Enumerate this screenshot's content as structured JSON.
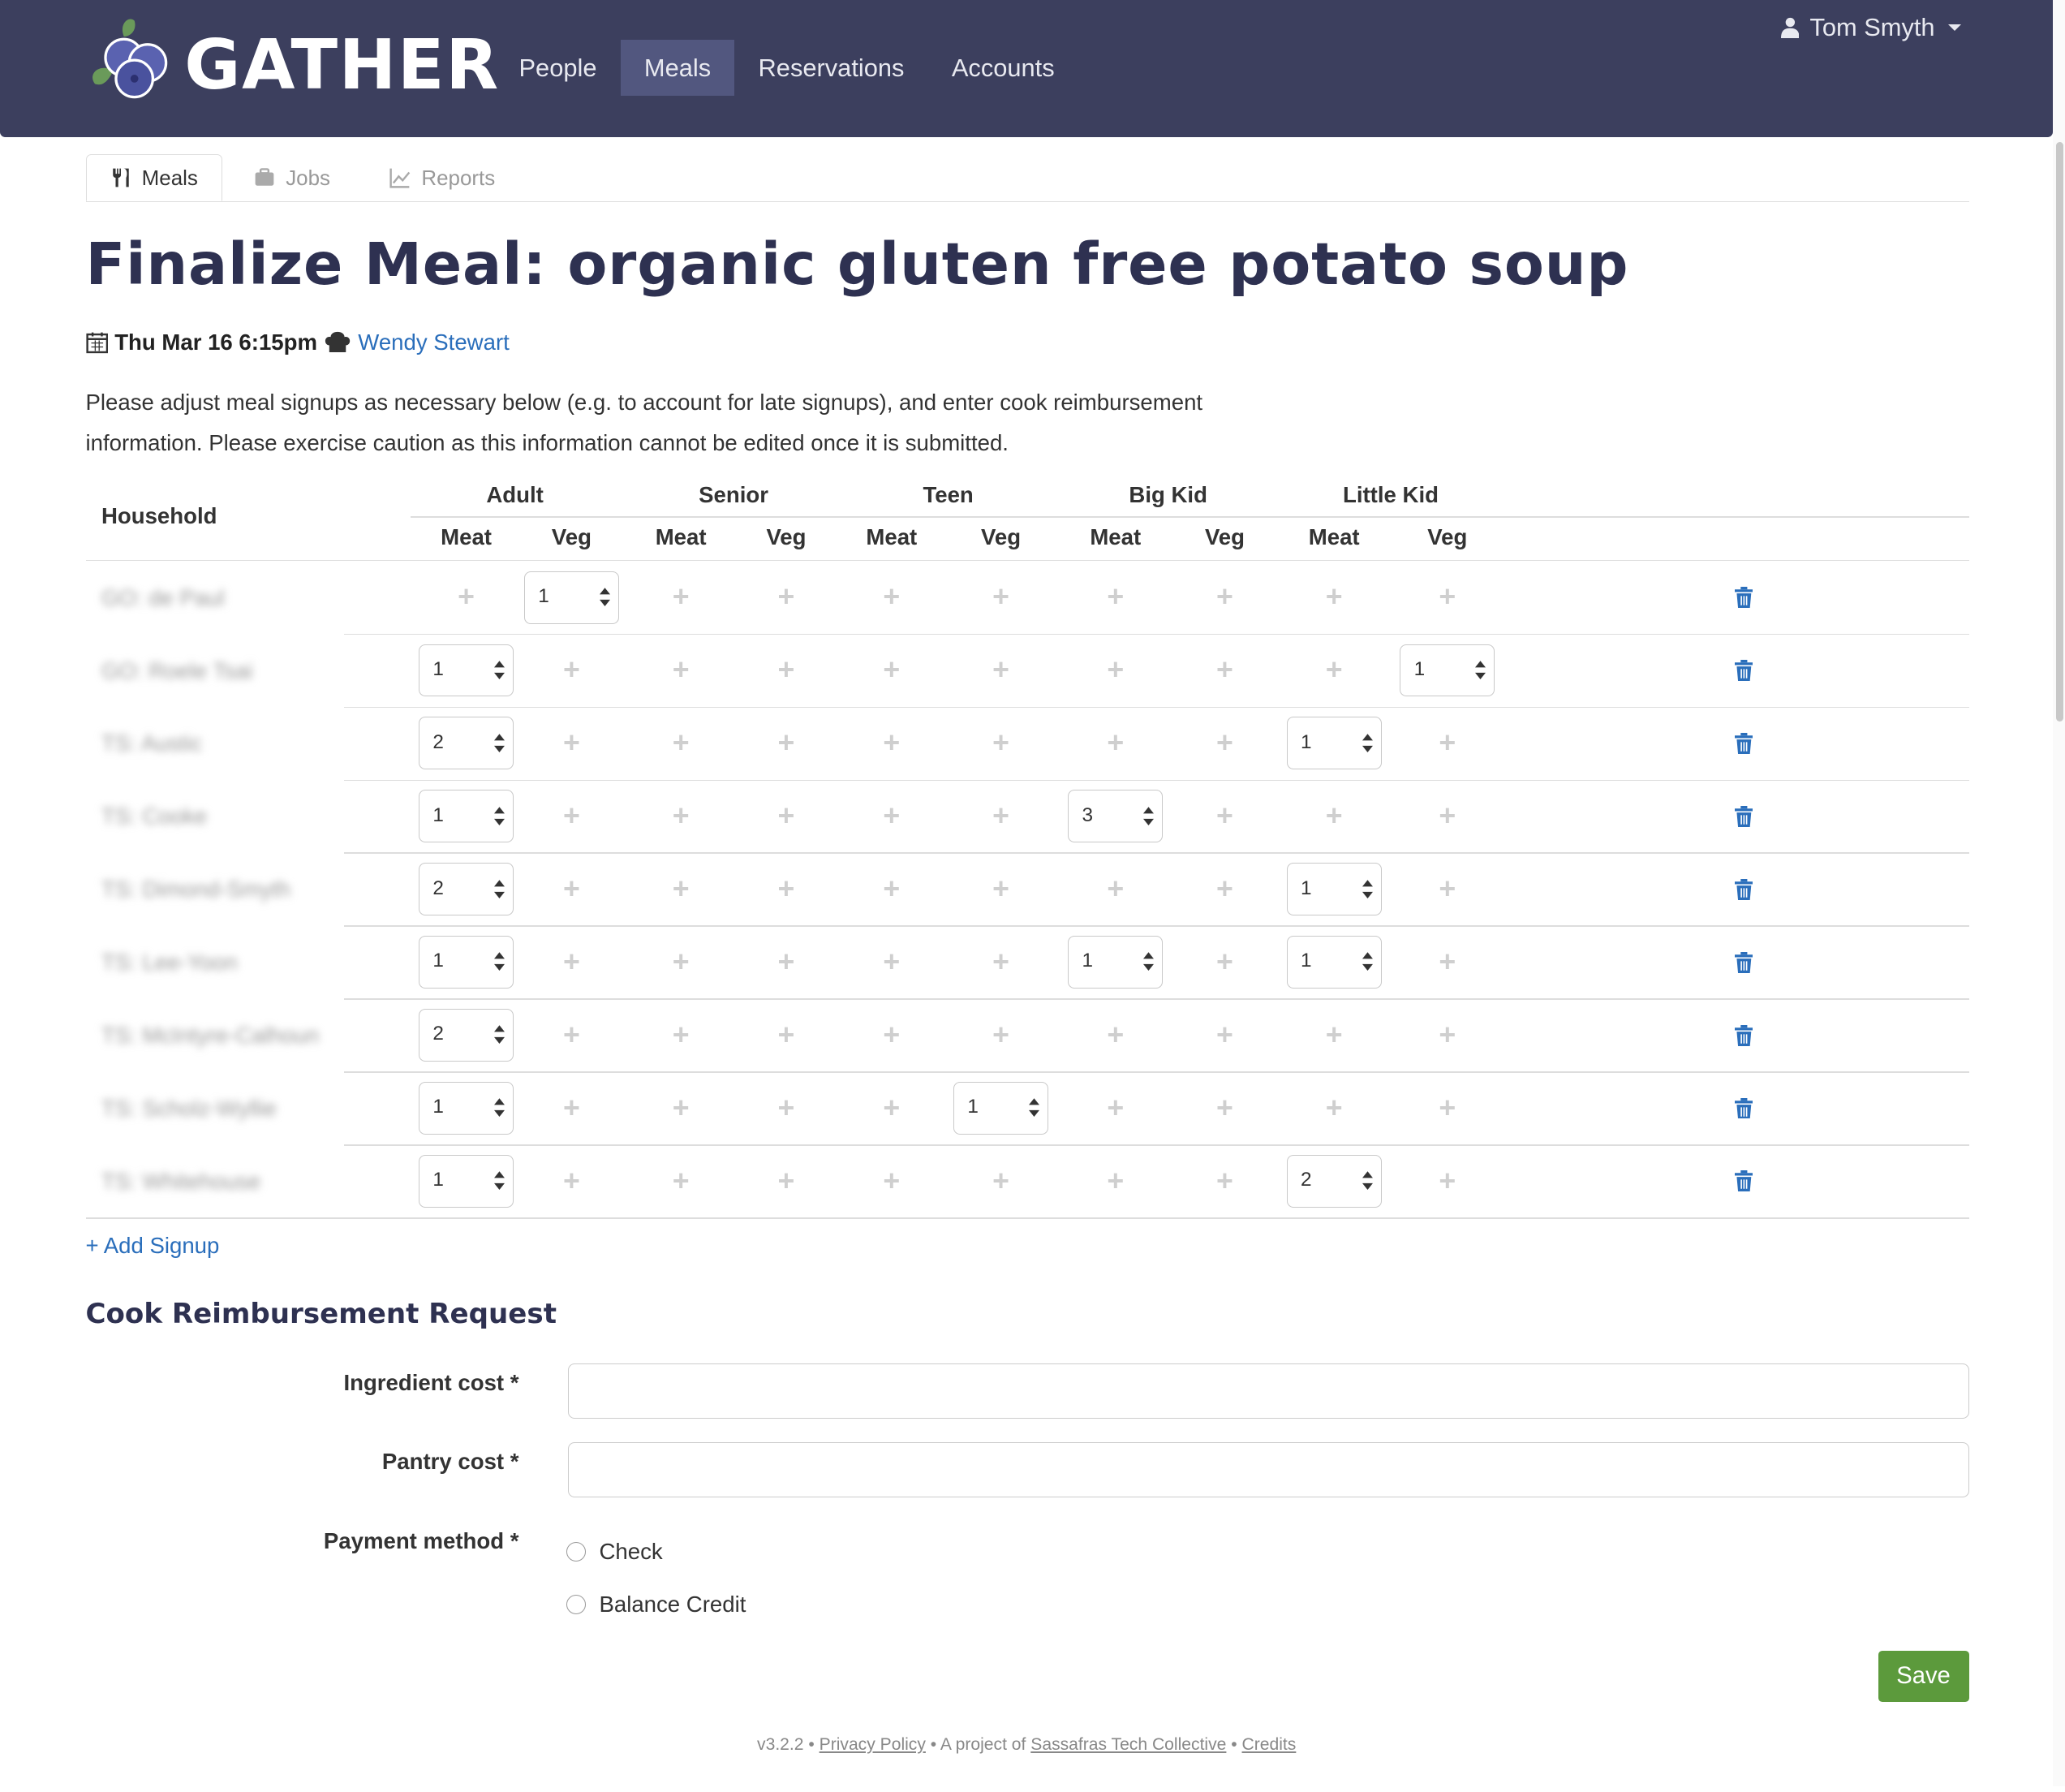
{
  "brand": {
    "name": "GATHER"
  },
  "nav": {
    "items": [
      {
        "label": "People",
        "active": false
      },
      {
        "label": "Meals",
        "active": true
      },
      {
        "label": "Reservations",
        "active": false
      },
      {
        "label": "Accounts",
        "active": false
      }
    ],
    "user": "Tom Smyth"
  },
  "subtabs": [
    {
      "label": "Meals",
      "icon": "cutlery-icon",
      "active": true
    },
    {
      "label": "Jobs",
      "icon": "briefcase-icon",
      "active": false
    },
    {
      "label": "Reports",
      "icon": "line-chart-icon",
      "active": false
    }
  ],
  "page": {
    "title": "Finalize Meal: organic gluten free potato soup",
    "date": "Thu Mar 16 6:15pm",
    "cook": "Wendy Stewart",
    "intro": "Please adjust meal signups as necessary below (e.g. to account for late signups), and enter cook reimbursement information. Please exercise caution as this information cannot be edited once it is submitted."
  },
  "table": {
    "household_header": "Household",
    "groups": [
      "Adult",
      "Senior",
      "Teen",
      "Big Kid",
      "Little Kid"
    ],
    "sub_headers": [
      "Meat",
      "Veg",
      "Meat",
      "Veg",
      "Meat",
      "Veg",
      "Meat",
      "Veg",
      "Meat",
      "Veg"
    ],
    "rows": [
      {
        "household": "GO: de Paul",
        "values": [
          null,
          1,
          null,
          null,
          null,
          null,
          null,
          null,
          null,
          null
        ]
      },
      {
        "household": "GO: Roele Tsai",
        "values": [
          1,
          null,
          null,
          null,
          null,
          null,
          null,
          null,
          null,
          1
        ]
      },
      {
        "household": "TS: Austic",
        "values": [
          2,
          null,
          null,
          null,
          null,
          null,
          null,
          null,
          1,
          null
        ]
      },
      {
        "household": "TS: Cooke",
        "values": [
          1,
          null,
          null,
          null,
          null,
          null,
          3,
          null,
          null,
          null
        ]
      },
      {
        "household": "TS: Dimond-Smyth",
        "values": [
          2,
          null,
          null,
          null,
          null,
          null,
          null,
          null,
          1,
          null
        ]
      },
      {
        "household": "TS: Lee-Yoon",
        "values": [
          1,
          null,
          null,
          null,
          null,
          null,
          1,
          null,
          1,
          null
        ]
      },
      {
        "household": "TS: McIntyre-Calhoun",
        "values": [
          2,
          null,
          null,
          null,
          null,
          null,
          null,
          null,
          null,
          null
        ]
      },
      {
        "household": "TS: Scholz-Wyllie",
        "values": [
          1,
          null,
          null,
          null,
          null,
          1,
          null,
          null,
          null,
          null
        ]
      },
      {
        "household": "TS: Whitehouse",
        "values": [
          1,
          null,
          null,
          null,
          null,
          null,
          null,
          null,
          2,
          null
        ]
      }
    ],
    "add_signup": "+ Add Signup"
  },
  "reimbursement": {
    "title": "Cook Reimbursement Request",
    "ingredient_label": "Ingredient cost *",
    "ingredient_value": "",
    "pantry_label": "Pantry cost *",
    "pantry_value": "",
    "payment_label": "Payment method *",
    "payment_options": [
      "Check",
      "Balance Credit"
    ],
    "save": "Save"
  },
  "footer": {
    "version": "v3.2.2",
    "privacy": "Privacy Policy",
    "project_text": "A project of",
    "collective": "Sassafras Tech Collective",
    "credits": "Credits"
  },
  "colors": {
    "navbar": "#3c3f5e",
    "active_nav": "#52577f",
    "title": "#2e3151",
    "link": "#2a6ebb",
    "save": "#5c9a3c"
  }
}
